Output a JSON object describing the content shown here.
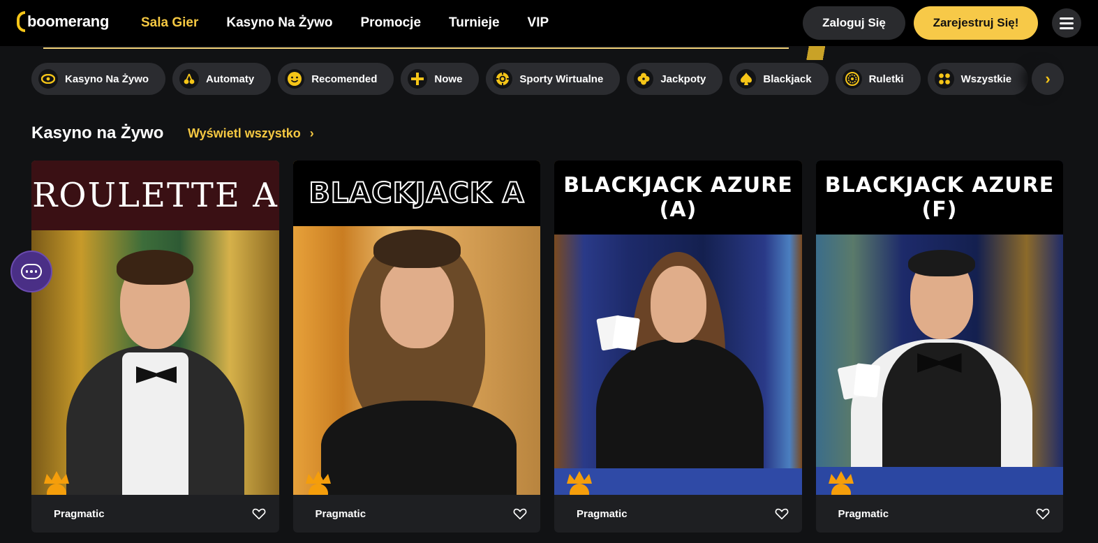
{
  "header": {
    "logo_text": "boomerang",
    "nav": [
      {
        "label": "Sala Gier",
        "active": true
      },
      {
        "label": "Kasyno Na Żywo",
        "active": false
      },
      {
        "label": "Promocje",
        "active": false
      },
      {
        "label": "Turnieje",
        "active": false
      },
      {
        "label": "VIP",
        "active": false
      }
    ],
    "login_label": "Zaloguj Się",
    "register_label": "Zarejestruj Się!"
  },
  "categories": [
    {
      "label": "Kasyno Na Żywo",
      "icon": "eye-icon"
    },
    {
      "label": "Automaty",
      "icon": "cherries-icon"
    },
    {
      "label": "Recomended",
      "icon": "smiley-icon"
    },
    {
      "label": "Nowe",
      "icon": "plus-icon"
    },
    {
      "label": "Sporty Wirtualne",
      "icon": "chip-icon"
    },
    {
      "label": "Jackpoty",
      "icon": "clover-icon"
    },
    {
      "label": "Blackjack",
      "icon": "spade-icon"
    },
    {
      "label": "Ruletki",
      "icon": "roulette-icon"
    },
    {
      "label": "Wszystkie",
      "icon": "grid-icon"
    }
  ],
  "section": {
    "title": "Kasyno na Żywo",
    "view_all": "Wyświetl wszystko"
  },
  "games": [
    {
      "title": "ROULETTE A",
      "provider": "Pragmatic"
    },
    {
      "title": "BLACKJACK A",
      "provider": "Pragmatic"
    },
    {
      "title": "BLACKJACK AZURE (A)",
      "provider": "Pragmatic"
    },
    {
      "title": "BLACKJACK AZURE (F)",
      "provider": "Pragmatic"
    }
  ],
  "colors": {
    "accent": "#f5c842",
    "register_bg": "#f7c948",
    "chip_bg": "#2b2c30",
    "chat_bg": "#4a2f86"
  }
}
